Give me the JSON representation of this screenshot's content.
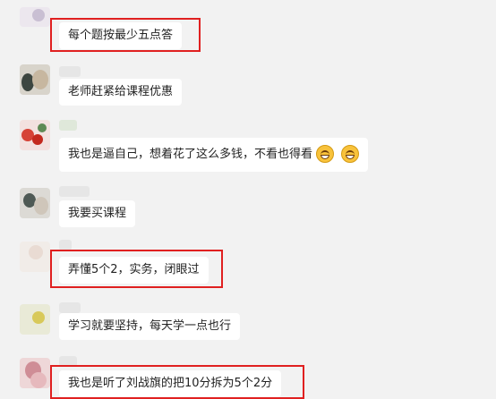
{
  "chat": {
    "messages": [
      {
        "text": "每个题按最少五点答",
        "highlighted": true
      },
      {
        "text": "老师赶紧给课程优惠",
        "highlighted": false
      },
      {
        "text": "我也是逼自己，想着花了这么多钱，不看也得看",
        "emoji_count": 2,
        "emoji": "grinning-face-emoji",
        "highlighted": false
      },
      {
        "text": "我要买课程",
        "highlighted": false
      },
      {
        "text": "弄懂5个2，实务，闭眼过",
        "highlighted": true
      },
      {
        "text": "学习就要坚持，每天学一点也行",
        "highlighted": false
      },
      {
        "text": "我也是听了刘战旗的把10分拆为5个2分",
        "highlighted": true
      }
    ]
  },
  "colors": {
    "background": "#f2f2f2",
    "bubble": "#ffffff",
    "highlight_border": "#e02020",
    "text": "#222222"
  }
}
